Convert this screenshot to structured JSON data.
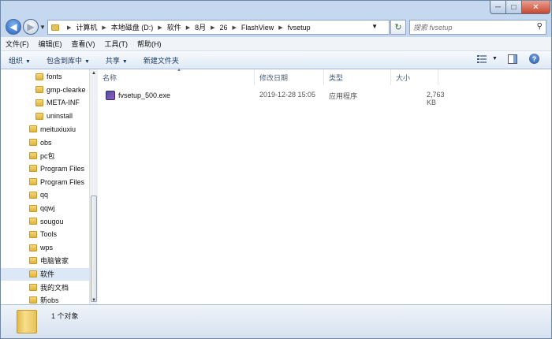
{
  "window": {
    "minimize_glyph": "─",
    "maximize_glyph": "□",
    "close_glyph": "✕"
  },
  "nav": {
    "back_glyph": "◀",
    "forward_glyph": "▶",
    "address": {
      "breadcrumbs": [
        "计算机",
        "本地磁盘 (D:)",
        "软件",
        "8月",
        "26",
        "FlashView",
        "fvsetup"
      ],
      "separator": "▶"
    },
    "refresh_glyph": "↻",
    "search": {
      "placeholder": "搜索 fvsetup",
      "icon": "search-icon"
    }
  },
  "menu": {
    "items": [
      "文件(F)",
      "编辑(E)",
      "查看(V)",
      "工具(T)",
      "帮助(H)"
    ]
  },
  "toolbar": {
    "organize": "组织",
    "include_library": "包含到库中",
    "share": "共享",
    "new_folder": "新建文件夹",
    "dropdown_glyph": "▼",
    "help_glyph": "?"
  },
  "tree": {
    "items": [
      {
        "label": "fonts",
        "indent": 1,
        "selected": false
      },
      {
        "label": "gmp-clearke",
        "indent": 1,
        "selected": false
      },
      {
        "label": "META-INF",
        "indent": 1,
        "selected": false
      },
      {
        "label": "uninstall",
        "indent": 1,
        "selected": false
      },
      {
        "label": "meituxiuxiu",
        "indent": 0,
        "selected": false
      },
      {
        "label": "obs",
        "indent": 0,
        "selected": false
      },
      {
        "label": "pc包",
        "indent": 0,
        "selected": false
      },
      {
        "label": "Program Files",
        "indent": 0,
        "selected": false
      },
      {
        "label": "Program Files",
        "indent": 0,
        "selected": false
      },
      {
        "label": "qq",
        "indent": 0,
        "selected": false
      },
      {
        "label": "qqwj",
        "indent": 0,
        "selected": false
      },
      {
        "label": "sougou",
        "indent": 0,
        "selected": false
      },
      {
        "label": "Tools",
        "indent": 0,
        "selected": false
      },
      {
        "label": "wps",
        "indent": 0,
        "selected": false
      },
      {
        "label": "电脑管家",
        "indent": 0,
        "selected": false
      },
      {
        "label": "软件",
        "indent": 0,
        "selected": true
      },
      {
        "label": "我的文档",
        "indent": 0,
        "selected": false
      },
      {
        "label": "新obs",
        "indent": 0,
        "selected": false
      }
    ]
  },
  "columns": {
    "name": "名称",
    "modified": "修改日期",
    "type": "类型",
    "size": "大小",
    "sort_glyph": "▲"
  },
  "files": [
    {
      "name": "fvsetup_500.exe",
      "modified": "2019-12-28 15:05",
      "type": "应用程序",
      "size": "2,763 KB"
    }
  ],
  "status": {
    "count_text": "1 个对象"
  },
  "colors": {
    "frame": "#b7cde9",
    "selected": "#dde8f6",
    "close": "#c8462f"
  }
}
